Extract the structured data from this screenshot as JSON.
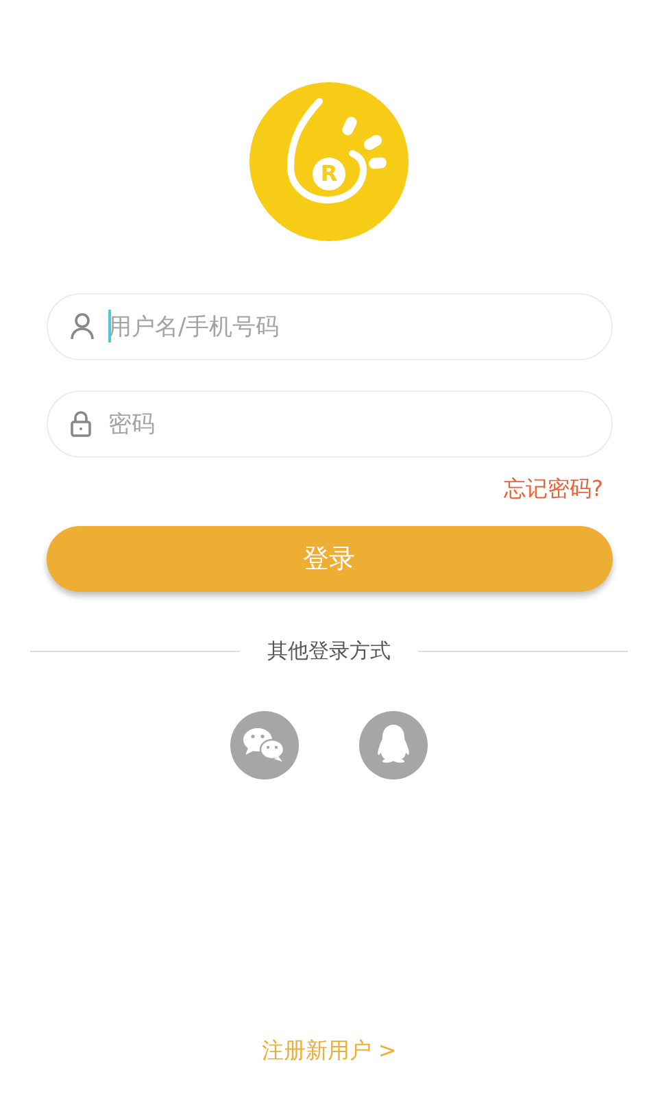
{
  "logo": {
    "letter": "R"
  },
  "fields": [
    {
      "kind": "user",
      "placeholder": "用户名/手机号码",
      "focused": true
    },
    {
      "kind": "lock",
      "placeholder": "密码",
      "focused": false
    }
  ],
  "forgot_link": "忘记密码?",
  "login_button": "登录",
  "divider_text": "其他登录方式",
  "social_logins": [
    {
      "kind": "wechat"
    },
    {
      "kind": "qq"
    }
  ],
  "register_link": "注册新用户 >"
}
